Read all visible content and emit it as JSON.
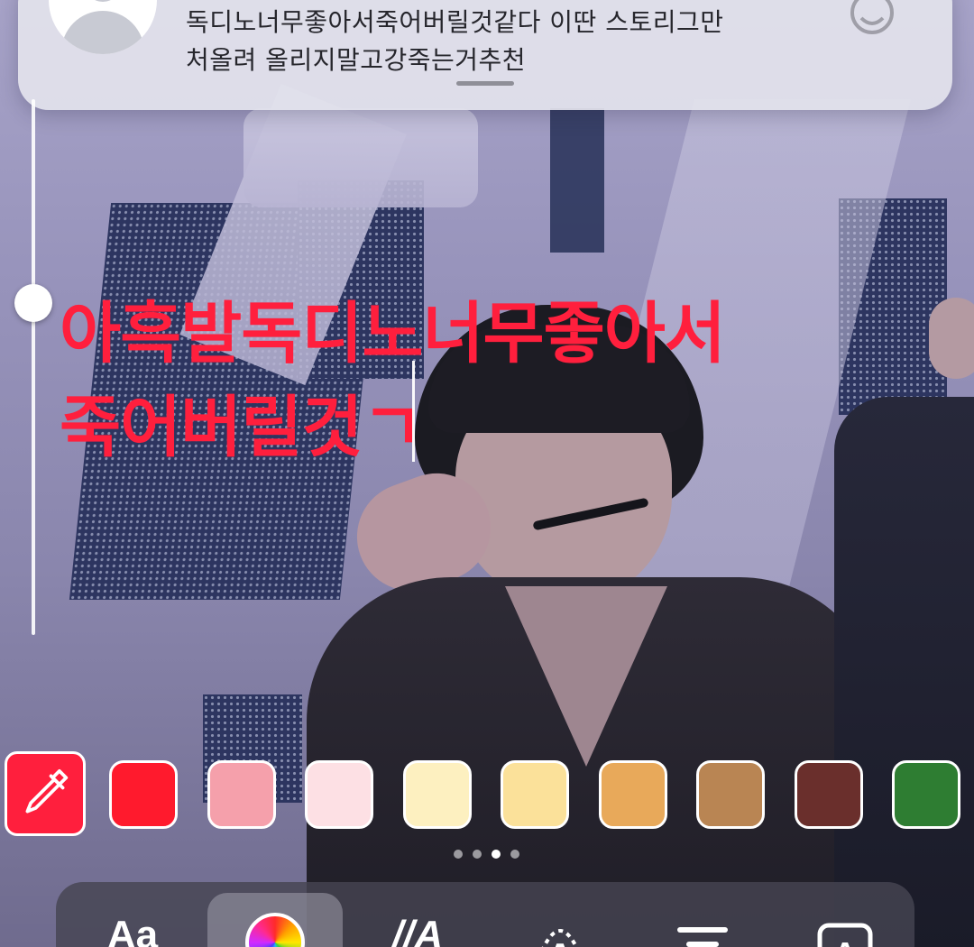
{
  "notification": {
    "avatar_icon": "default-avatar-icon",
    "line1": "독디노너무좋아서죽어버릴것같다 이딴 스토리그만",
    "line2": "처올려 올리지말고강죽는거추천",
    "react_icon": "smiley-icon"
  },
  "editor": {
    "story_text_line1": "아흑발독디노너무좋아서",
    "story_text_line2": "죽어버릴것ㄱ",
    "text_color": "#ff1f3d",
    "text_size_level": 0.62
  },
  "palette": {
    "eyedropper_icon": "eyedropper-icon",
    "swatches": [
      "#ff1a2d",
      "#f5a0ab",
      "#fde0e4",
      "#fdf0c0",
      "#fbe19a",
      "#e8a95a",
      "#b98553",
      "#6a2f2c",
      "#2e7d32"
    ],
    "page_count": 4,
    "active_page": 3
  },
  "toolbar": {
    "font_label": "Aa",
    "color_icon": "color-wheel-icon",
    "effect_label": "//A",
    "animate_label": "A",
    "align_icon": "align-center-icon",
    "background_label": "A"
  }
}
